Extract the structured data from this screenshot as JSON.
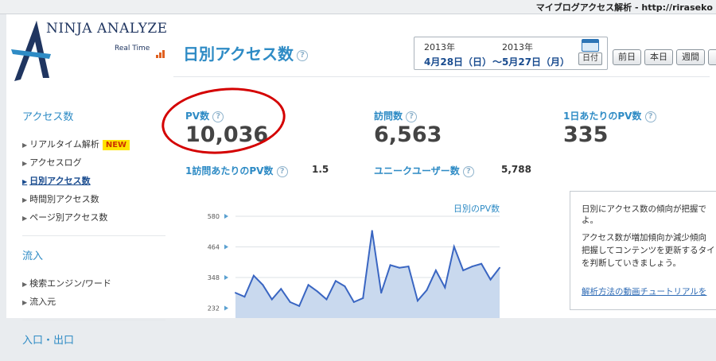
{
  "window": {
    "title": "マイブログアクセス解析 - http://rirasekо"
  },
  "logo": {
    "name": "NINJA ANALYZE",
    "subtitle": "Real Time"
  },
  "page": {
    "title": "日別アクセス数"
  },
  "date_range": {
    "start_year": "2013年",
    "start_date": "4月28日（日）",
    "end_year": "2013年",
    "end_date": "～5月27日（月）",
    "calendar_label": "日付"
  },
  "nav_buttons": [
    "前日",
    "本日",
    "週間",
    "月"
  ],
  "sidebar": {
    "sections": [
      {
        "heading": "アクセス数",
        "items": [
          {
            "label": "リアルタイム解析",
            "badge": "NEW"
          },
          {
            "label": "アクセスログ"
          },
          {
            "label": "日別アクセス数",
            "active": true
          },
          {
            "label": "時間別アクセス数"
          },
          {
            "label": "ページ別アクセス数"
          }
        ]
      },
      {
        "heading": "流入",
        "items": [
          {
            "label": "検索エンジン/ワード"
          },
          {
            "label": "流入元"
          }
        ]
      },
      {
        "heading": "入口・出口",
        "items": []
      }
    ]
  },
  "stats": {
    "pv": {
      "label": "PV数",
      "value": "10,036"
    },
    "visits": {
      "label": "訪問数",
      "value": "6,563"
    },
    "pv_per_day": {
      "label": "1日あたりのPV数",
      "value": "335"
    },
    "pv_per_visit": {
      "label": "1訪問あたりのPV数",
      "value": "1.5"
    },
    "unique_users": {
      "label": "ユニークユーザー数",
      "value": "5,788"
    }
  },
  "chart_data": {
    "type": "area",
    "title": "日別のPV数",
    "y_ticks": [
      "580",
      "464",
      "348",
      "232"
    ],
    "ylim": [
      232,
      580
    ],
    "grid": true,
    "values": [
      290,
      275,
      355,
      320,
      265,
      305,
      255,
      240,
      320,
      295,
      265,
      335,
      315,
      255,
      270,
      525,
      290,
      395,
      385,
      390,
      260,
      300,
      375,
      310,
      465,
      375,
      390,
      400,
      340,
      385
    ]
  },
  "info": {
    "lines": [
      "日別にアクセス数の傾向が把握で",
      "よ。",
      "アクセス数が増加傾向か減少傾向",
      "把握してコンテンツを更新するタイ",
      "を判断していきましょう。"
    ],
    "link": "解析方法の動画チュートリアルを"
  }
}
